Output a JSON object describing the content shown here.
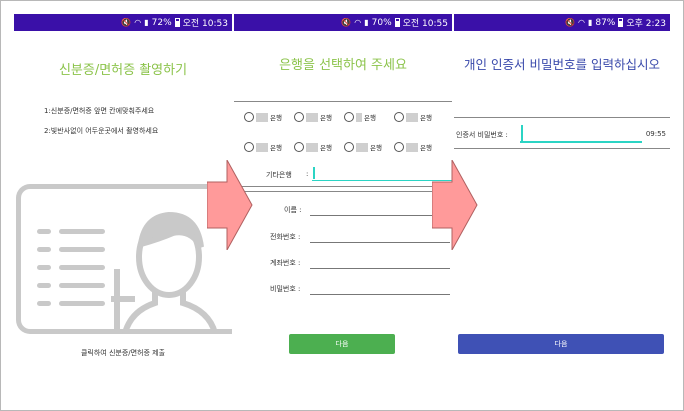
{
  "colors": {
    "statusbar": "#3a10a8",
    "green": "#8bc34a",
    "green_button": "#4caf50",
    "blue": "#3f51b5",
    "arrow": "#ff9a9a",
    "cursor": "#2bd4c4"
  },
  "screen1": {
    "status": {
      "battery": "72%",
      "time": "오전 10:53"
    },
    "title": "신분증/면허증 촬영하기",
    "step1": "1:신분증/면허증 앞면 칸에맞춰주세요",
    "step2": "2:빛반사없이 어두운곳에서 촬영하세요",
    "footer": "클릭하여 신분증/면허증 제출"
  },
  "screen2": {
    "status": {
      "battery": "70%",
      "time": "오전 10:55"
    },
    "title": "은행을 선택하여 주세요",
    "banks": [
      {
        "suffix": "은행"
      },
      {
        "suffix": "은행"
      },
      {
        "suffix": "은행"
      },
      {
        "suffix": "은행"
      },
      {
        "suffix": "은행"
      },
      {
        "suffix": "은행"
      },
      {
        "suffix": "은행"
      },
      {
        "suffix": "은행"
      }
    ],
    "other_bank_label": "기타은행",
    "fields": {
      "name": "이름 :",
      "phone": "전화번호 :",
      "account": "계좌번호 :",
      "password": "비밀번호 :"
    },
    "next_button": "다음"
  },
  "screen3": {
    "status": {
      "battery": "87%",
      "time": "오후 2:23"
    },
    "title": "개인 인증서 비밀번호를 입력하십시오",
    "password_label": "인증서 비밀번호 :",
    "timer": "09:55",
    "next_button": "다음"
  }
}
